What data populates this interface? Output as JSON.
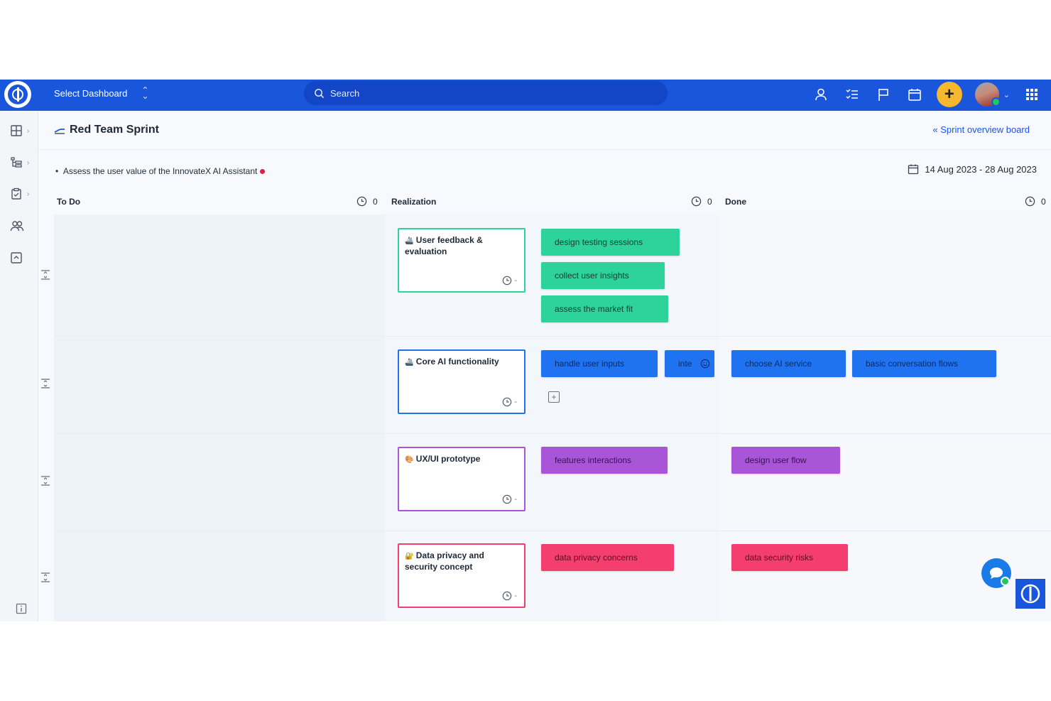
{
  "topbar": {
    "dashboard_label": "Select Dashboard",
    "search_placeholder": "Search"
  },
  "page": {
    "title": "Red Team Sprint",
    "overview_link": "« Sprint overview board",
    "goal": "Assess the user value of the InnovateX AI Assistant",
    "dates": "14 Aug 2023 - 28 Aug 2023"
  },
  "columns": [
    {
      "name": "To Do",
      "count": "0"
    },
    {
      "name": "Realization",
      "count": "0"
    },
    {
      "name": "Done",
      "count": "0"
    }
  ],
  "stories": [
    {
      "title": "User feedback & evaluation",
      "time": "-",
      "color": "#2dd39a"
    },
    {
      "title": "Core AI functionality",
      "time": "-",
      "color": "#1f73f0"
    },
    {
      "title": "UX/UI prototype",
      "time": "-",
      "color": "#a855d8"
    },
    {
      "title": "Data privacy and security concept",
      "time": "-",
      "color": "#f43f6e"
    }
  ],
  "tasks": {
    "lane1_realization": [
      "design testing sessions",
      "collect user insights",
      "assess the market fit"
    ],
    "lane2_realization": [
      "handle user inputs"
    ],
    "lane2_editing_value": "inte",
    "lane2_done": [
      "choose AI service",
      "basic conversation flows"
    ],
    "lane3_realization": [
      "features interactions"
    ],
    "lane3_done": [
      "design user flow"
    ],
    "lane4_realization": [
      "data privacy concerns"
    ],
    "lane4_done": [
      "data security risks"
    ]
  },
  "colors": {
    "brand": "#1a56db",
    "accent": "#f5b82e"
  }
}
